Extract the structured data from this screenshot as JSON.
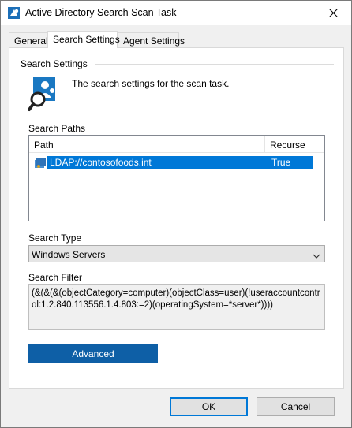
{
  "window": {
    "title": "Active Directory Search Scan Task"
  },
  "tabs": [
    {
      "label": "General"
    },
    {
      "label": "Search Settings",
      "active": true
    },
    {
      "label": "Agent Settings"
    }
  ],
  "panel": {
    "group_title": "Search Settings",
    "description": "The search settings for the scan task.",
    "search_paths_label": "Search Paths",
    "columns": [
      "Path",
      "Recurse"
    ],
    "rows": [
      {
        "path": "LDAP://contosofoods.int",
        "recurse": "True",
        "selected": true
      }
    ],
    "search_type_label": "Search Type",
    "search_type_value": "Windows Servers",
    "search_filter_label": "Search Filter",
    "search_filter_value": "(&(&(&(objectCategory=computer)(objectClass=user)(!useraccountcontrol:1.2.840.113556.1.4.803:=2)(operatingSystem=*server*))))",
    "advanced_label": "Advanced"
  },
  "buttons": {
    "ok_label": "OK",
    "cancel_label": "Cancel"
  },
  "colors": {
    "accent": "#0078d7",
    "advanced_button": "#0e5fa6"
  },
  "icons": {
    "app": "ad-scan-icon",
    "close": "close-icon",
    "banner": "user-search-icon",
    "row": "ldap-folder-icon",
    "dropdown": "chevron-down-icon"
  }
}
